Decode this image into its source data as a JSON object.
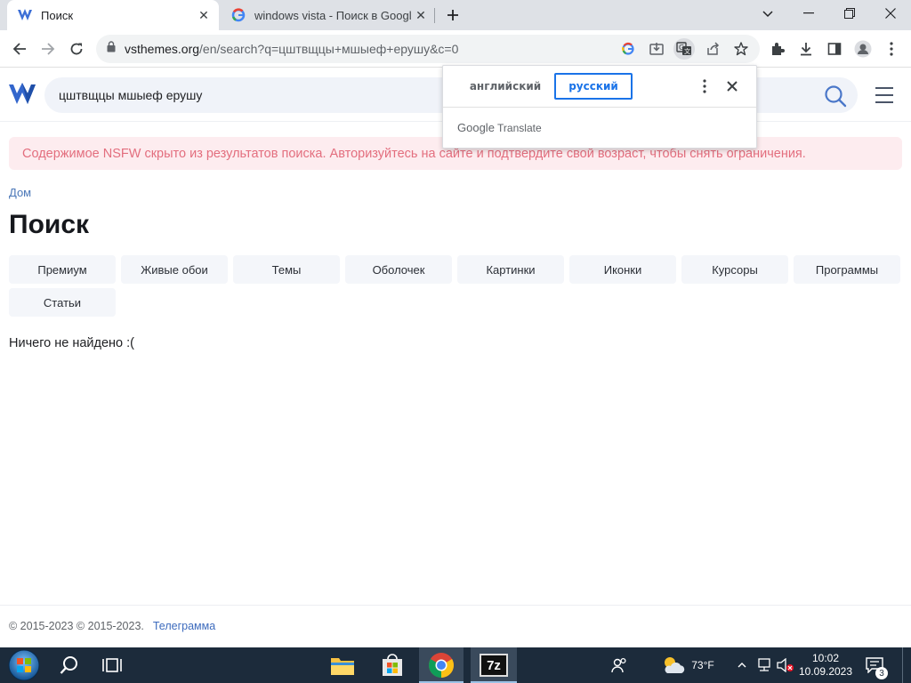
{
  "browser": {
    "tabs": [
      {
        "title": "Поиск",
        "active": true
      },
      {
        "title": "windows vista - Поиск в Google",
        "active": false
      }
    ],
    "url_host": "vsthemes.org",
    "url_path": "/en/search?q=цштвщцы+мшыеф+ерушу&c=0"
  },
  "translate_popup": {
    "source_language": "английский",
    "target_language": "русский",
    "brand": "Google",
    "product": "Translate"
  },
  "site": {
    "search_value": "цштвщцы мшыеф ерушу",
    "nsfw_notice": "Содержимое NSFW скрыто из результатов поиска. Авторизуйтесь на сайте и подтвердите свой возраст, чтобы снять ограничения.",
    "breadcrumb": "Дом",
    "page_title": "Поиск",
    "categories": [
      "Премиум",
      "Живые обои",
      "Темы",
      "Оболочек",
      "Картинки",
      "Иконки",
      "Курсоры",
      "Программы",
      "Статьи"
    ],
    "no_results": "Ничего не найдено :(",
    "footer_copyright": "© 2015-2023 © 2015-2023.",
    "footer_link": "Телеграмма"
  },
  "taskbar": {
    "weather_temp": "73°F",
    "time": "10:02",
    "date": "10.09.2023",
    "notifications_count": "3",
    "seven_zip_label": "7z"
  }
}
